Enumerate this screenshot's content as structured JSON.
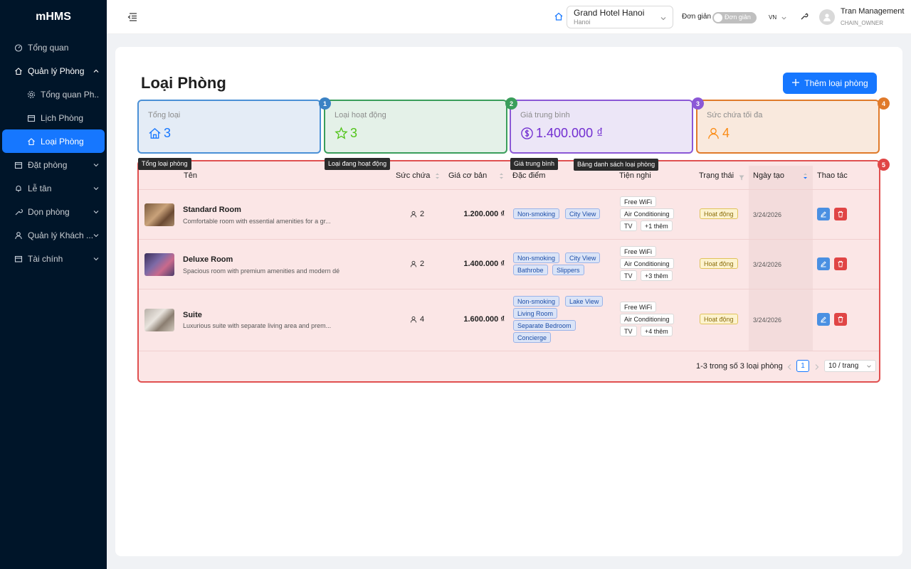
{
  "app": {
    "logo": "mHMS"
  },
  "sidebar": {
    "items": [
      {
        "label": "Tổng quan",
        "icon": "dashboard-icon"
      },
      {
        "label": "Quản lý Phòng",
        "icon": "home-icon",
        "expanded": true
      },
      {
        "label": "Tổng quan Ph...",
        "icon": "gear-icon",
        "sub": true
      },
      {
        "label": "Lịch Phòng",
        "icon": "calendar-icon",
        "sub": true
      },
      {
        "label": "Loại Phòng",
        "icon": "home-icon",
        "sub": true,
        "active": true
      },
      {
        "label": "Đặt phòng",
        "icon": "calendar-icon"
      },
      {
        "label": "Lễ tân",
        "icon": "bell-icon"
      },
      {
        "label": "Dọn phòng",
        "icon": "tool-icon"
      },
      {
        "label": "Quản lý Khách ...",
        "icon": "user-icon"
      },
      {
        "label": "Tài chính",
        "icon": "wallet-icon"
      }
    ]
  },
  "header": {
    "hotel_name": "Grand Hotel Hanoi",
    "hotel_city": "Hanoi",
    "mode_label": "Đơn giản",
    "mode_switch_text": "Đơn giản",
    "language": "VN",
    "user_name": "Tran Management",
    "user_role": "CHAIN_OWNER"
  },
  "page": {
    "title": "Loại Phòng",
    "add_button": "Thêm loại phòng"
  },
  "stats": [
    {
      "label": "Tổng loại",
      "value": "3",
      "icon": "home-icon",
      "badge": "1"
    },
    {
      "label": "Loại hoạt động",
      "value": "3",
      "icon": "star-icon",
      "badge": "2"
    },
    {
      "label": "Giá trung bình",
      "value": "1.400.000 ₫",
      "icon": "dollar-icon",
      "badge": "3"
    },
    {
      "label": "Sức chứa tối đa",
      "value": "4",
      "icon": "user-icon",
      "badge": "4"
    }
  ],
  "overlays": {
    "tag1": "Tổng loại phòng",
    "tag2": "Loại đang hoạt động",
    "tag3": "Giá trung bình",
    "tag4": "Bảng danh sách loại phòng",
    "badge5": "5"
  },
  "table": {
    "headers": {
      "name": "Tên",
      "capacity": "Sức chứa",
      "price": "Giá cơ bản",
      "features": "Đặc điểm",
      "amenities": "Tiện nghi",
      "status": "Trạng thái",
      "created": "Ngày tạo",
      "actions": "Thao tác"
    },
    "rows": [
      {
        "name": "Standard Room",
        "desc": "Comfortable room with essential amenities for a gr...",
        "capacity": "2",
        "price": "1.200.000 ₫",
        "features": [
          "Non-smoking",
          "City View"
        ],
        "amenities": [
          "Free WiFi",
          "Air Conditioning",
          "TV",
          "+1 thêm"
        ],
        "status": "Hoạt động",
        "created": "3/24/2026"
      },
      {
        "name": "Deluxe Room",
        "desc": "Spacious room with premium amenities and modern dé...",
        "capacity": "2",
        "price": "1.400.000 ₫",
        "features": [
          "Non-smoking",
          "City View",
          "Bathrobe",
          "Slippers"
        ],
        "amenities": [
          "Free WiFi",
          "Air Conditioning",
          "TV",
          "+3 thêm"
        ],
        "status": "Hoạt động",
        "created": "3/24/2026"
      },
      {
        "name": "Suite",
        "desc": "Luxurious suite with separate living area and prem...",
        "capacity": "4",
        "price": "1.600.000 ₫",
        "features": [
          "Non-smoking",
          "Lake View",
          "Living Room",
          "Separate Bedroom",
          "Concierge"
        ],
        "amenities": [
          "Free WiFi",
          "Air Conditioning",
          "TV",
          "+4 thêm"
        ],
        "status": "Hoạt động",
        "created": "3/24/2026"
      }
    ],
    "pagination": {
      "summary": "1-3 trong số 3 loại phòng",
      "current_page": "1",
      "page_size": "10 / trang"
    }
  },
  "colors": {
    "sidebar_bg": "#001529",
    "primary": "#1677ff",
    "table_highlight": "#e05050"
  }
}
